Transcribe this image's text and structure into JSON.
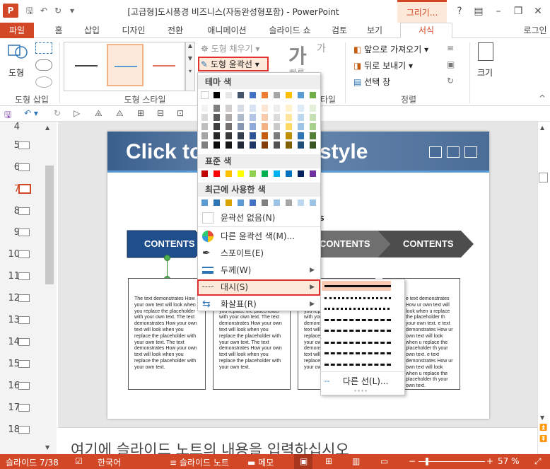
{
  "window": {
    "title": "[고급형]도시풍경 비즈니스(자동완성형포함) - PowerPoint",
    "context_tab_group": "그리기...",
    "help": "?",
    "login": "로그인"
  },
  "tabs": {
    "file": "파일",
    "items": [
      "홈",
      "삽입",
      "디자인",
      "전환",
      "애니메이션",
      "슬라이드 쇼",
      "검토",
      "보기"
    ],
    "format": "서식"
  },
  "ribbon": {
    "shape_label": "도형",
    "group_insert_shapes": "도형 삽입",
    "group_shape_styles": "도형 스타일",
    "group_wordart_partial": "타일",
    "group_arrange": "정렬",
    "fill": "도형 채우기",
    "outline": "도형 윤곽선",
    "bring_forward": "앞으로 가져오기",
    "send_backward": "뒤로 보내기",
    "selection_pane": "선택 창",
    "size": "크기",
    "quick_styles_partial": "빠른",
    "ga_glyph": "가",
    "ga_glyph2": "가"
  },
  "slide_thumbs": {
    "numbers": [
      "4",
      "5",
      "6",
      "7",
      "8",
      "9",
      "10",
      "11",
      "12",
      "13",
      "14",
      "15",
      "16",
      "17",
      "18"
    ],
    "selected": "7"
  },
  "slide": {
    "title_left": "Click to",
    "title_right": "style",
    "subtitle_partial": "ts",
    "chevrons": [
      "CONTENTS",
      "CONTENTS",
      "CONTENTS"
    ],
    "box_text": "The text demonstrates How your own text will look when you replace the placeholder with your own text. The text demonstrates How your own text will look when you replace the placeholder with your own text. The text demonstrates How your own text will look when you replace the placeholder with your own text.",
    "box_text_partial": "e text demonstrates How ur own text will look when u replace the placeholder th your own text. e text demonstrates How ur own text will look when u replace the placeholder th your own text. e text demonstrates How ur own text will look when u replace the placeholder th your own text."
  },
  "notes": {
    "placeholder": "여기에 슬라이드 노트의 내용을 입력하십시오"
  },
  "dropdown": {
    "theme_colors_header": "테마 색",
    "standard_colors_header": "표준 색",
    "recent_colors_header": "최근에 사용한 색",
    "no_outline": "윤곽선 없음(N)",
    "more_colors": "다른 윤곽선 색(M)...",
    "eyedropper": "스포이트(E)",
    "weight": "두께(W)",
    "dashes": "대시(S)",
    "arrows": "화살표(R)",
    "theme_top_row": [
      "#ffffff",
      "#000000",
      "#e7e6e6",
      "#44546a",
      "#4472c4",
      "#ed7d31",
      "#a5a5a5",
      "#ffc000",
      "#5b9bd5",
      "#70ad47"
    ],
    "theme_columns": [
      [
        "#f2f2f2",
        "#d8d8d8",
        "#bfbfbf",
        "#a5a5a5",
        "#7f7f7f"
      ],
      [
        "#7f7f7f",
        "#595959",
        "#3f3f3f",
        "#262626",
        "#0c0c0c"
      ],
      [
        "#d0cece",
        "#aeaaaa",
        "#757070",
        "#3a3838",
        "#171616"
      ],
      [
        "#d6dce4",
        "#adb9ca",
        "#8496b0",
        "#323f4f",
        "#222a35"
      ],
      [
        "#d9e2f3",
        "#b4c6e7",
        "#8eaadb",
        "#2f5496",
        "#1f3864"
      ],
      [
        "#fbe5d5",
        "#f7cbac",
        "#f4b183",
        "#c55a11",
        "#833c0b"
      ],
      [
        "#ededed",
        "#dbdbdb",
        "#c9c9c9",
        "#7b7b7b",
        "#525252"
      ],
      [
        "#fff2cc",
        "#ffe599",
        "#ffd966",
        "#bf8f00",
        "#7f6000"
      ],
      [
        "#deebf6",
        "#bdd7ee",
        "#9dc3e6",
        "#2e75b5",
        "#1f4e79"
      ],
      [
        "#e2efd9",
        "#c5e0b3",
        "#a8d08d",
        "#538135",
        "#375623"
      ]
    ],
    "standard": [
      "#c00000",
      "#ff0000",
      "#ffc000",
      "#ffff00",
      "#92d050",
      "#00b050",
      "#00b0f0",
      "#0070c0",
      "#002060",
      "#7030a0"
    ],
    "recent": [
      "#5b9bd5",
      "#2e75b5",
      "#d9a300",
      "#5b9bd5",
      "#4472c4",
      "#808080",
      "#9dc3e6",
      "#a5a5a5",
      "#bdd7ee",
      "#9dc3e6"
    ]
  },
  "dash_submenu": {
    "more_lines": "다른 선(L)..."
  },
  "status": {
    "slide_count": "슬라이드 7/38",
    "language": "한국어",
    "notes": "슬라이드 노트",
    "comments": "메모",
    "zoom": "57 %"
  },
  "colors": {
    "accent": "#d24726",
    "highlight_border": "#e03030",
    "highlight_fill": "#fde9d9",
    "chevron_blue": "#1f4e8c",
    "chevron_gray": "#5a5a5a"
  }
}
